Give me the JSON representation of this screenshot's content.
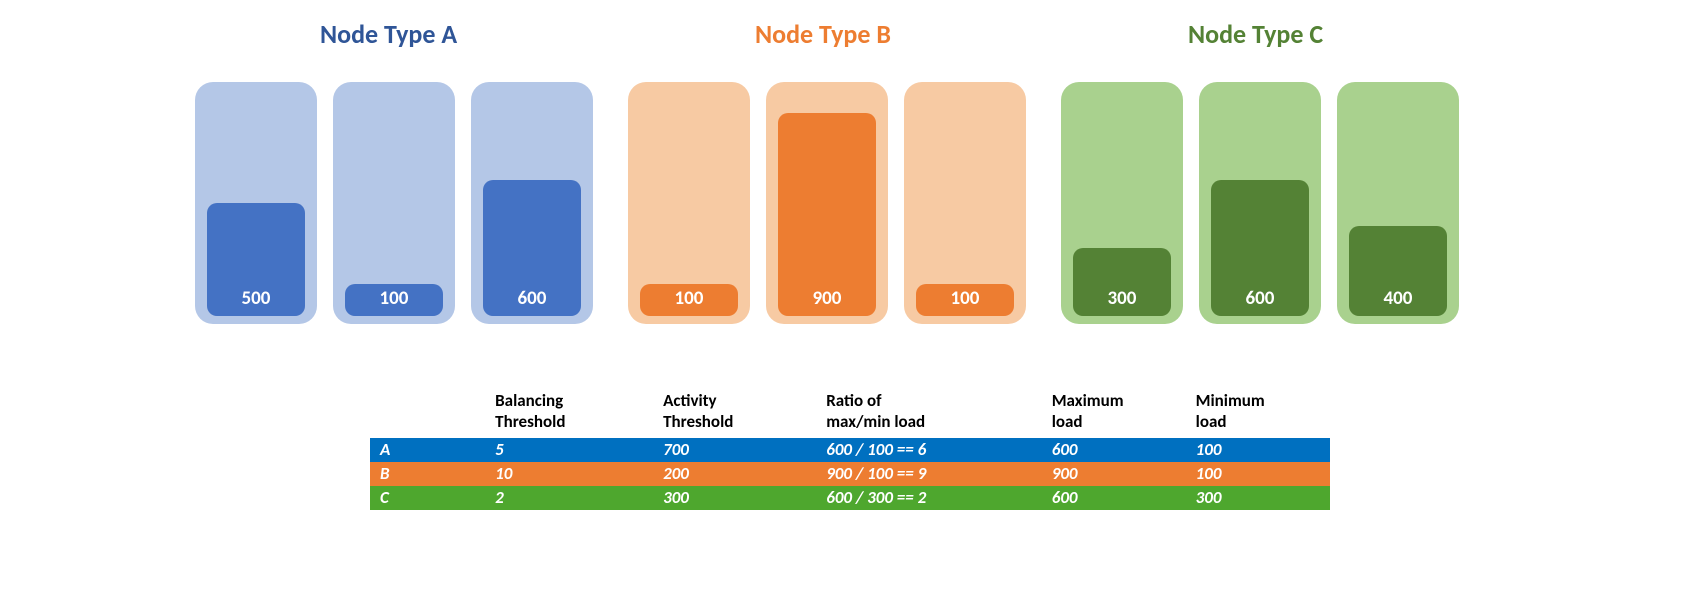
{
  "groups": {
    "A": {
      "title": "Node Type A",
      "title_color": "#2f5597",
      "nodes": [
        500,
        100,
        600
      ]
    },
    "B": {
      "title": "Node Type B",
      "title_color": "#ed7d31",
      "nodes": [
        100,
        900,
        100
      ]
    },
    "C": {
      "title": "Node Type C",
      "title_color": "#548235",
      "nodes": [
        300,
        600,
        400
      ]
    }
  },
  "table": {
    "headers": {
      "col0": "",
      "col1": "Balancing Threshold",
      "col2": "Activity Threshold",
      "col3": "Ratio of max/min load",
      "col4": "Maximum load",
      "col5": "Minimum load"
    },
    "rows": {
      "A": {
        "label": "A",
        "balancing": "5",
        "activity": "700",
        "ratio": "600 / 100 == 6",
        "max": "600",
        "min": "100"
      },
      "B": {
        "label": "B",
        "balancing": "10",
        "activity": "200",
        "ratio": "900 / 100 == 9",
        "max": "900",
        "min": "100"
      },
      "C": {
        "label": "C",
        "balancing": "2",
        "activity": "300",
        "ratio": "600 / 300 == 2",
        "max": "600",
        "min": "300"
      }
    }
  },
  "chart_data": {
    "type": "bar",
    "title": "",
    "series": [
      {
        "name": "Node Type A",
        "values": [
          500,
          100,
          600
        ]
      },
      {
        "name": "Node Type B",
        "values": [
          100,
          900,
          100
        ]
      },
      {
        "name": "Node Type C",
        "values": [
          300,
          600,
          400
        ]
      }
    ],
    "ylim": [
      0,
      1000
    ]
  }
}
